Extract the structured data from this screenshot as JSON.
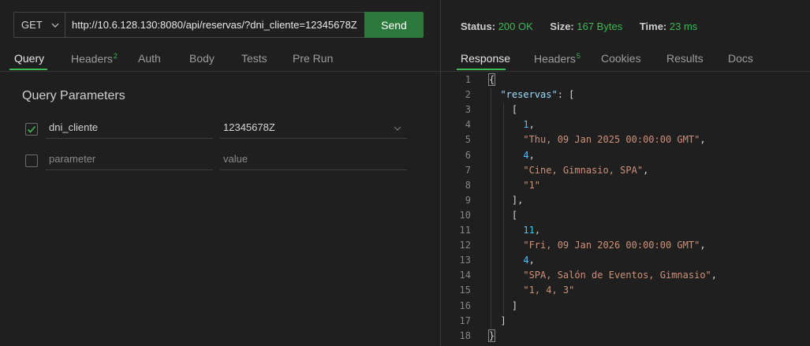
{
  "request": {
    "method": "GET",
    "url": "http://10.6.128.130:8080/api/reservas/?dni_cliente=12345678Z",
    "send_label": "Send"
  },
  "request_tabs": [
    {
      "label": "Query",
      "active": true
    },
    {
      "label": "Headers",
      "badge": "2"
    },
    {
      "label": "Auth"
    },
    {
      "label": "Body"
    },
    {
      "label": "Tests"
    },
    {
      "label": "Pre Run"
    }
  ],
  "query": {
    "title": "Query Parameters",
    "params": [
      {
        "checked": true,
        "name": "dni_cliente",
        "value": "12345678Z"
      },
      {
        "checked": false,
        "name_placeholder": "parameter",
        "value_placeholder": "value"
      }
    ]
  },
  "response_meta": {
    "status_label": "Status:",
    "status_value": "200 OK",
    "size_label": "Size:",
    "size_value": "167 Bytes",
    "time_label": "Time:",
    "time_value": "23 ms"
  },
  "response_tabs": [
    {
      "label": "Response",
      "active": true
    },
    {
      "label": "Headers",
      "badge": "5"
    },
    {
      "label": "Cookies"
    },
    {
      "label": "Results"
    },
    {
      "label": "Docs"
    }
  ],
  "colors": {
    "accent_green": "#3fb950",
    "send_button": "#2c7a3b",
    "json_key": "#9cdcfe",
    "json_string": "#ce9178",
    "json_number": "#4fc1ff"
  },
  "response_body": [
    {
      "n": "1",
      "tokens": [
        [
          "p",
          "{"
        ]
      ]
    },
    {
      "n": "2",
      "tokens": [
        [
          "p",
          "  "
        ],
        [
          "k",
          "\"reservas\""
        ],
        [
          "p",
          ": ["
        ]
      ]
    },
    {
      "n": "3",
      "tokens": [
        [
          "p",
          "    ["
        ]
      ]
    },
    {
      "n": "4",
      "tokens": [
        [
          "p",
          "      "
        ],
        [
          "n",
          "1"
        ],
        [
          "p",
          ","
        ]
      ]
    },
    {
      "n": "5",
      "tokens": [
        [
          "p",
          "      "
        ],
        [
          "s",
          "\"Thu, 09 Jan 2025 00:00:00 GMT\""
        ],
        [
          "p",
          ","
        ]
      ]
    },
    {
      "n": "6",
      "tokens": [
        [
          "p",
          "      "
        ],
        [
          "n",
          "4"
        ],
        [
          "p",
          ","
        ]
      ]
    },
    {
      "n": "7",
      "tokens": [
        [
          "p",
          "      "
        ],
        [
          "s",
          "\"Cine, Gimnasio, SPA\""
        ],
        [
          "p",
          ","
        ]
      ]
    },
    {
      "n": "8",
      "tokens": [
        [
          "p",
          "      "
        ],
        [
          "s",
          "\"1\""
        ]
      ]
    },
    {
      "n": "9",
      "tokens": [
        [
          "p",
          "    ],"
        ]
      ]
    },
    {
      "n": "10",
      "tokens": [
        [
          "p",
          "    ["
        ]
      ]
    },
    {
      "n": "11",
      "tokens": [
        [
          "p",
          "      "
        ],
        [
          "n",
          "11"
        ],
        [
          "p",
          ","
        ]
      ]
    },
    {
      "n": "12",
      "tokens": [
        [
          "p",
          "      "
        ],
        [
          "s",
          "\"Fri, 09 Jan 2026 00:00:00 GMT\""
        ],
        [
          "p",
          ","
        ]
      ]
    },
    {
      "n": "13",
      "tokens": [
        [
          "p",
          "      "
        ],
        [
          "n",
          "4"
        ],
        [
          "p",
          ","
        ]
      ]
    },
    {
      "n": "14",
      "tokens": [
        [
          "p",
          "      "
        ],
        [
          "s",
          "\"SPA, Salón de Eventos, Gimnasio\""
        ],
        [
          "p",
          ","
        ]
      ]
    },
    {
      "n": "15",
      "tokens": [
        [
          "p",
          "      "
        ],
        [
          "s",
          "\"1, 4, 3\""
        ]
      ]
    },
    {
      "n": "16",
      "tokens": [
        [
          "p",
          "    ]"
        ]
      ]
    },
    {
      "n": "17",
      "tokens": [
        [
          "p",
          "  ]"
        ]
      ]
    },
    {
      "n": "18",
      "tokens": [
        [
          "p",
          "}"
        ]
      ]
    }
  ]
}
